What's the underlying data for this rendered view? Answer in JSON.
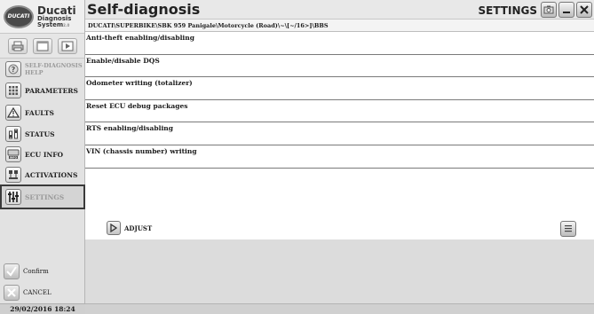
{
  "brand": {
    "badge": "DUCATI",
    "name": "Ducati",
    "line2": "Diagnosis",
    "line3": "System",
    "line3_small": "2.0"
  },
  "header": {
    "title": "Self-diagnosis",
    "section": "SETTINGS"
  },
  "path": "DUCATI\\SUPERBIKE\\SBK 959 Panigale\\Motorcycle (Road)\\~\\[~/16>]\\BBS",
  "sidebar": {
    "items": [
      {
        "label": "SELF-DIAGNOSIS HELP",
        "icon": "help-icon"
      },
      {
        "label": "PARAMETERS",
        "icon": "parameters-grid-icon"
      },
      {
        "label": "FAULTS",
        "icon": "warning-triangle-icon"
      },
      {
        "label": "STATUS",
        "icon": "status-toggle-icon"
      },
      {
        "label": "ECU INFO",
        "icon": "ecu-info-icon"
      },
      {
        "label": "ACTIVATIONS",
        "icon": "activations-icon"
      },
      {
        "label": "SETTINGS",
        "icon": "settings-icon"
      }
    ],
    "confirm_label": "Confirm",
    "cancel_label": "CANCEL",
    "datetime": "29/02/2016  18:24"
  },
  "settings_list": [
    "Anti-theft enabling/disabling",
    "Enable/disable DQS",
    "Odometer writing (totalizer)",
    "Reset ECU debug packages",
    "RTS enabling/disabling",
    "VIN (chassis number) writing"
  ],
  "actions": {
    "adjust_label": "ADJUST"
  }
}
